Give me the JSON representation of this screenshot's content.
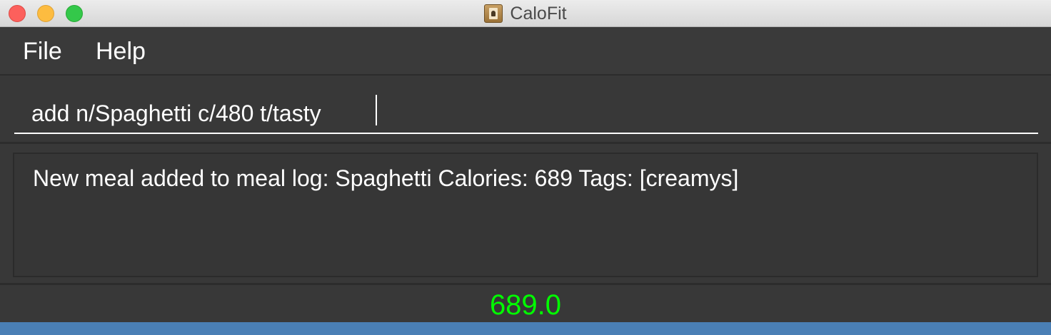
{
  "window": {
    "title": "CaloFit"
  },
  "menu": {
    "file_label": "File",
    "help_label": "Help"
  },
  "command": {
    "value": "add n/Spaghetti c/480 t/tasty"
  },
  "result": {
    "message": "New meal added to meal log: Spaghetti Calories: 689 Tags: [creamys]"
  },
  "calorie_total": "689.0",
  "colors": {
    "background": "#383838",
    "calorie_text": "#00ff00",
    "bottom_bar": "#4a7fb5"
  },
  "icons": {
    "app": "contacts-book-icon"
  }
}
